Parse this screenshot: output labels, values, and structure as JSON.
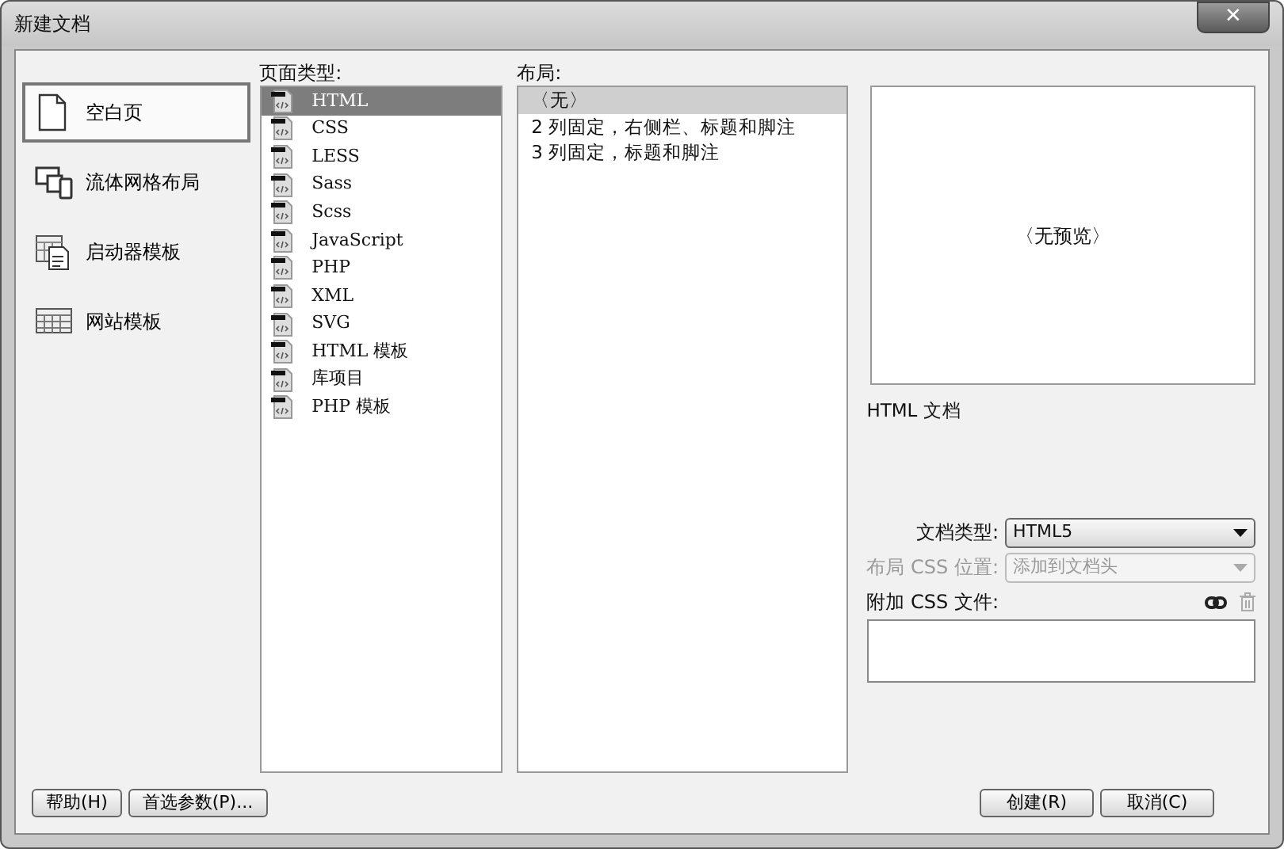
{
  "window": {
    "title": "新建文档",
    "close": "✕"
  },
  "categories": [
    {
      "label": "空白页",
      "kind": "blank",
      "selected": true
    },
    {
      "label": "流体网格布局",
      "kind": "fluid",
      "selected": false
    },
    {
      "label": "启动器模板",
      "kind": "starter",
      "selected": false
    },
    {
      "label": "网站模板",
      "kind": "site",
      "selected": false
    }
  ],
  "page_type": {
    "label": "页面类型:",
    "items": [
      {
        "label": "HTML",
        "selected": true
      },
      {
        "label": "CSS",
        "selected": false
      },
      {
        "label": "LESS",
        "selected": false
      },
      {
        "label": "Sass",
        "selected": false
      },
      {
        "label": "Scss",
        "selected": false
      },
      {
        "label": "JavaScript",
        "selected": false
      },
      {
        "label": "PHP",
        "selected": false
      },
      {
        "label": "XML",
        "selected": false
      },
      {
        "label": "SVG",
        "selected": false
      },
      {
        "label": "HTML 模板",
        "selected": false
      },
      {
        "label": "库项目",
        "selected": false
      },
      {
        "label": "PHP 模板",
        "selected": false
      }
    ]
  },
  "layout": {
    "label": "布局:",
    "items": [
      {
        "label": "〈无〉",
        "selected": true
      },
      {
        "label": "2 列固定，右侧栏、标题和脚注",
        "selected": false
      },
      {
        "label": "3 列固定，标题和脚注",
        "selected": false
      }
    ]
  },
  "preview": {
    "text": "〈无预览〉"
  },
  "description": "HTML 文档",
  "selects": [
    {
      "label": "文档类型:",
      "value": "HTML5",
      "disabled": false
    },
    {
      "label": "布局 CSS 位置:",
      "value": "添加到文档头",
      "disabled": true
    }
  ],
  "attach_css": {
    "label": "附加 CSS 文件:"
  },
  "buttons_left": [
    "帮助(H)",
    "首选参数(P)..."
  ],
  "buttons_right": [
    "创建(R)",
    "取消(C)"
  ]
}
